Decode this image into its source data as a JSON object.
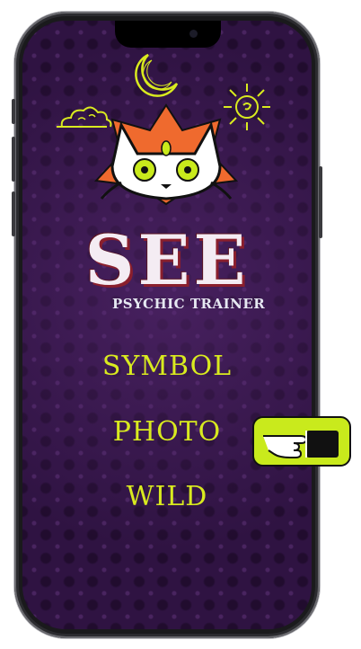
{
  "app": {
    "title": "SEE",
    "subtitle": "PSYCHIC TRAINER"
  },
  "menu": {
    "items": [
      {
        "label": "SYMBOL"
      },
      {
        "label": "PHOTO"
      },
      {
        "label": "WILD"
      }
    ]
  },
  "icons": {
    "logo": "cat-face-logo",
    "moon": "crescent-moon-icon",
    "sun": "sun-icon",
    "cloud": "cloud-icon",
    "pointer": "pointing-hand-icon"
  },
  "colors": {
    "background": "#2f1342",
    "menu_text": "#d9ea1f",
    "accent_lime": "#c9ea1c",
    "accent_orange": "#ef6a2e",
    "title_text": "#f4ecf3",
    "title_shadow": "#8a1f2d"
  }
}
